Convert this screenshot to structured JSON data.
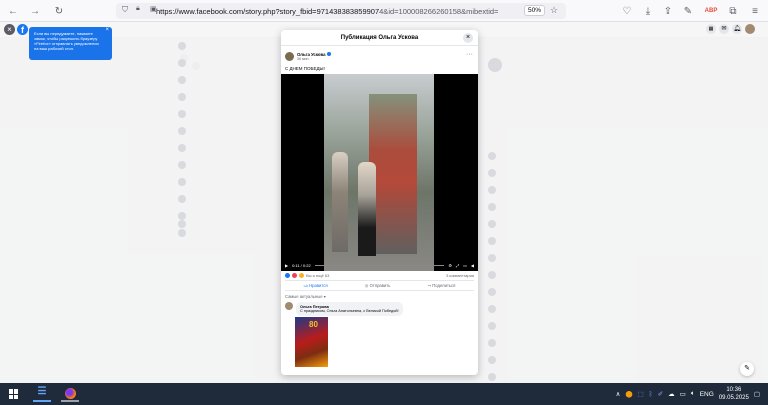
{
  "browser": {
    "url_main": "https://www.facebook.com/story.php?story_fbid=971438383859907",
    "url_tail": "4&id=100008266260158&mibextid=",
    "zoom": "50%"
  },
  "notification": {
    "text": "Если вы передумаете, нажмите замок, чтобы разрешить браузеру «Firefox» отправлять уведомления на ваш рабочий стол.",
    "close": "×"
  },
  "modal": {
    "title": "Публикация Ольга Ускова",
    "close": "×",
    "author": "Ольга Ускова",
    "time": "36 мин. ·",
    "text": "С ДНЕМ ПОБЕДЫ!",
    "video_time": "0:11 / 0:22",
    "reactions_text": "Вы и ещё 63",
    "comments_count": "3 комментария",
    "actions": {
      "like": "Нравится",
      "send": "Отправить",
      "share": "Поделиться"
    },
    "sort": "Самые актуальные ▾",
    "comment": {
      "author": "Ольга Петрова",
      "text": "С праздником, Ольга Анатольевна, с Великой Победой!",
      "image_label": "80"
    }
  },
  "taskbar": {
    "lang": "ENG",
    "time": "10:36",
    "date": "09.05.2025"
  },
  "colors": {
    "fb_blue": "#1877f2",
    "notif_blue": "#1a73e8",
    "taskbar": "#1f2a3a"
  }
}
